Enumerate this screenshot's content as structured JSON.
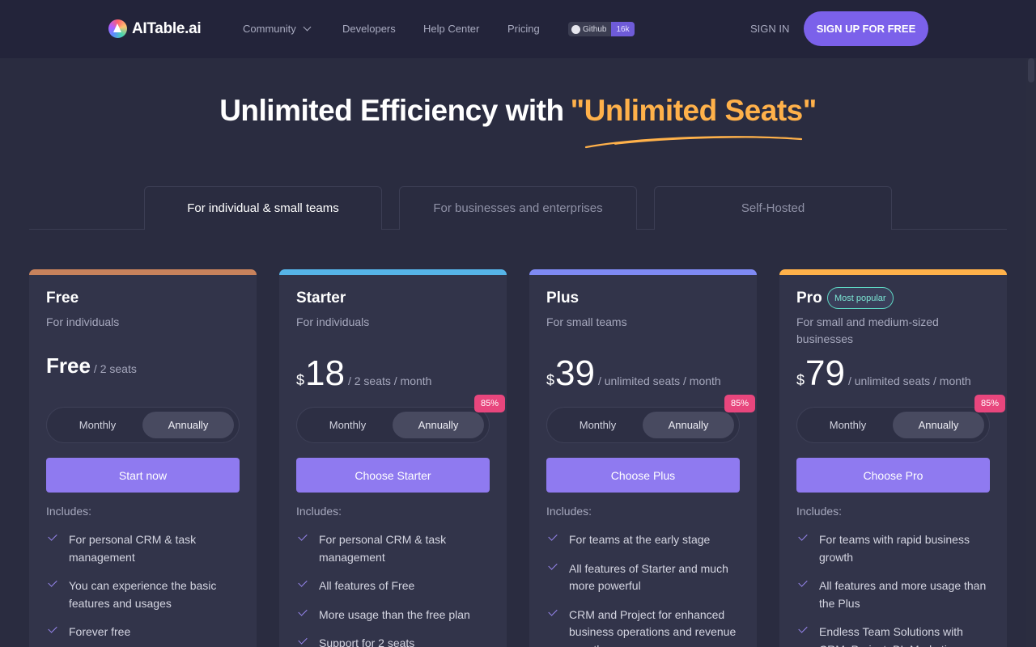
{
  "nav": {
    "logo_text": "AITable.ai",
    "links": [
      "Community",
      "Developers",
      "Help Center",
      "Pricing"
    ],
    "github_label": "Github",
    "github_count": "16k",
    "signin": "SIGN IN",
    "signup": "SIGN UP FOR FREE"
  },
  "hero": {
    "title_prefix": "Unlimited Efficiency with",
    "title_highlight": "\"Unlimited Seats\""
  },
  "tabs": [
    {
      "label": "For individual & small teams",
      "active": true
    },
    {
      "label": "For businesses and enterprises",
      "active": false
    },
    {
      "label": "Self-Hosted",
      "active": false
    }
  ],
  "colors": {
    "accent": "#8f7af0",
    "free_bar": "#c8825c",
    "starter_bar": "#56b4e8",
    "plus_bar": "#7f8af4",
    "pro_bar": "#ffb14a",
    "discount": "#e8467d"
  },
  "plans": [
    {
      "name": "Free",
      "subtitle": "For individuals",
      "price_text": "Free",
      "unit_text": "/ 2  seats",
      "toggle_monthly": "Monthly",
      "toggle_annually": "Annually",
      "cta": "Start now",
      "includes": "Includes:",
      "features": [
        "For personal CRM & task management",
        "You can experience the basic features and usages",
        "Forever free"
      ]
    },
    {
      "name": "Starter",
      "subtitle": "For individuals",
      "currency": "$",
      "price": "18",
      "unit_text": "/ 2  seats  / month",
      "discount": "85%",
      "toggle_monthly": "Monthly",
      "toggle_annually": "Annually",
      "cta": "Choose Starter",
      "includes": "Includes:",
      "features": [
        "For personal CRM & task management",
        "All features of Free",
        "More usage than the free plan",
        "Support for 2 seats"
      ]
    },
    {
      "name": "Plus",
      "subtitle": "For small teams",
      "currency": "$",
      "price": "39",
      "unit_text": "/ unlimited  seats  / month",
      "discount": "85%",
      "toggle_monthly": "Monthly",
      "toggle_annually": "Annually",
      "cta": "Choose Plus",
      "includes": "Includes:",
      "features": [
        "For teams at the early stage",
        "All features of Starter and much more powerful",
        "CRM and Project for enhanced business operations and revenue growth"
      ]
    },
    {
      "name": "Pro",
      "badge": "Most popular",
      "subtitle": "For small and medium-sized businesses",
      "currency": "$",
      "price": "79",
      "unit_text": "/ unlimited  seats  / month",
      "discount": "85%",
      "toggle_monthly": "Monthly",
      "toggle_annually": "Annually",
      "cta": "Choose Pro",
      "includes": "Includes:",
      "features": [
        "For teams with rapid business growth",
        "All features and more usage than the Plus",
        "Endless Team Solutions with CRM, Project, BI, Marketing"
      ]
    }
  ]
}
